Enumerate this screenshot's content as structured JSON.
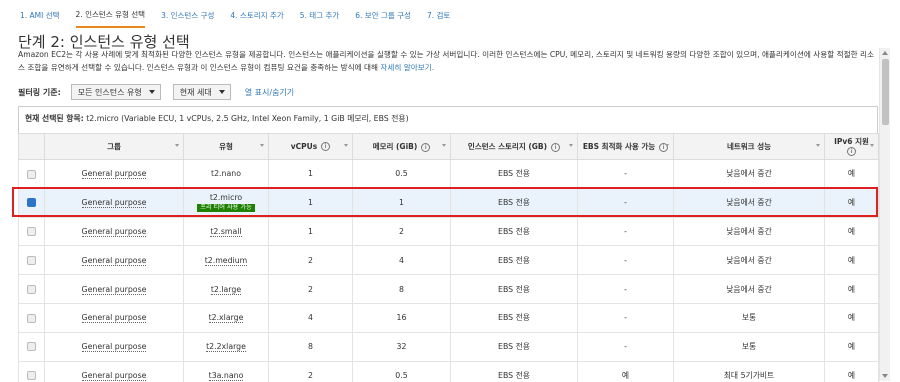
{
  "steps": [
    "1. AMI 선택",
    "2. 인스턴스 유형 선택",
    "3. 인스턴스 구성",
    "4. 스토리지 추가",
    "5. 태그 추가",
    "6. 보안 그룹 구성",
    "7. 검토"
  ],
  "title": "단계 2: 인스턴스 유형 선택",
  "description": "Amazon EC2는 각 사용 사례에 맞게 최적화된 다양한 인스턴스 유형을 제공합니다. 인스턴스는 애플리케이션을 실행할 수 있는 가상 서버입니다. 이러한 인스턴스에는 CPU, 메모리, 스토리지 및 네트워킹 용량의 다양한 조합이 있으며, 애플리케이션에 사용할 적절한 리소스 조합을 유연하게 선택할 수 있습니다. 인스턴스 유형과 이 인스턴스 유형이 컴퓨팅 요건을 충족하는 방식에 대해 ",
  "description_link": "자세히 알아보기.",
  "filter": {
    "label": "필터링 기준:",
    "type_select": "모든 인스턴스 유형",
    "gen_select": "현재 세대",
    "toggle_columns": "열 표시/숨기기"
  },
  "current": {
    "label": "현재 선택된 항목:",
    "value": "t2.micro (Variable ECU, 1 vCPUs, 2.5 GHz, Intel Xeon Family, 1 GiB 메모리, EBS 전용)"
  },
  "table": {
    "headers": {
      "family": "그룹",
      "type": "유형",
      "vcpus": "vCPUs",
      "memory": "메모리 (GiB)",
      "storage": "인스턴스 스토리지 (GB)",
      "ebs_opt": "EBS 최적화 사용 가능",
      "network": "네트워크 성능",
      "ipv6": "IPv6 지원"
    },
    "info_glyph": "i",
    "free_tier_label": "프리 티어 사용 가능",
    "rows": [
      {
        "family": "General purpose",
        "type": "t2.nano",
        "vcpus": "1",
        "memory": "0.5",
        "storage": "EBS 전용",
        "ebs_opt": "-",
        "network": "낮음에서 중간",
        "ipv6": "예"
      },
      {
        "family": "General purpose",
        "type": "t2.micro",
        "vcpus": "1",
        "memory": "1",
        "storage": "EBS 전용",
        "ebs_opt": "-",
        "network": "낮음에서 중간",
        "ipv6": "예"
      },
      {
        "family": "General purpose",
        "type": "t2.small",
        "vcpus": "1",
        "memory": "2",
        "storage": "EBS 전용",
        "ebs_opt": "-",
        "network": "낮음에서 중간",
        "ipv6": "예"
      },
      {
        "family": "General purpose",
        "type": "t2.medium",
        "vcpus": "2",
        "memory": "4",
        "storage": "EBS 전용",
        "ebs_opt": "-",
        "network": "낮음에서 중간",
        "ipv6": "예"
      },
      {
        "family": "General purpose",
        "type": "t2.large",
        "vcpus": "2",
        "memory": "8",
        "storage": "EBS 전용",
        "ebs_opt": "-",
        "network": "낮음에서 중간",
        "ipv6": "예"
      },
      {
        "family": "General purpose",
        "type": "t2.xlarge",
        "vcpus": "4",
        "memory": "16",
        "storage": "EBS 전용",
        "ebs_opt": "-",
        "network": "보통",
        "ipv6": "예"
      },
      {
        "family": "General purpose",
        "type": "t2.2xlarge",
        "vcpus": "8",
        "memory": "32",
        "storage": "EBS 전용",
        "ebs_opt": "-",
        "network": "보통",
        "ipv6": "예"
      },
      {
        "family": "General purpose",
        "type": "t3a.nano",
        "vcpus": "2",
        "memory": "0.5",
        "storage": "EBS 전용",
        "ebs_opt": "예",
        "network": "최대 5기가비트",
        "ipv6": "예"
      }
    ]
  },
  "colors": {
    "accent": "#e8871e",
    "link": "#2f78b8",
    "highlight": "#e02020",
    "free_tier": "#1d8102",
    "checkbox_selected": "#2c74c8"
  }
}
